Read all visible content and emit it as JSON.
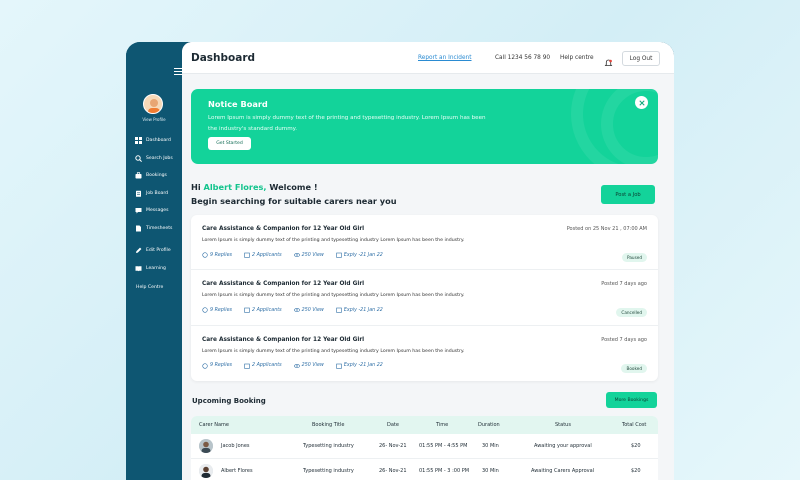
{
  "sidebar": {
    "view_profile": "View Profile",
    "items": [
      {
        "label": "Dashboard",
        "icon": "grid-icon"
      },
      {
        "label": "Search Jobs",
        "icon": "search-icon"
      },
      {
        "label": "Bookings",
        "icon": "briefcase-icon"
      },
      {
        "label": "Job Board",
        "icon": "clipboard-icon"
      },
      {
        "label": "Messages",
        "icon": "chat-icon"
      },
      {
        "label": "Timesheets",
        "icon": "document-icon"
      },
      {
        "label": "Edit Profile",
        "icon": "edit-icon"
      },
      {
        "label": "Learning",
        "icon": "book-icon"
      }
    ],
    "help": "Help Centre"
  },
  "header": {
    "title": "Dashboard",
    "report_link": "Report an Incident",
    "call": "Call 1234 56 78 90",
    "help": "Help centre",
    "logout": "Log Out"
  },
  "notice": {
    "title": "Notice Board",
    "text": "Lorem Ipsum is simply dummy text of the printing and typesetting industry. Lorem Ipsum has been the industry's standard dummy.",
    "button": "Get Started"
  },
  "greeting": {
    "hi": "Hi",
    "name": "Albert Flores,",
    "welcome": "Welcome !",
    "line2": "Begin searching for suitable carers near you",
    "post_job": "Post a Job"
  },
  "jobs": [
    {
      "title": "Care Assistance & Companion for 12 Year Old Girl",
      "desc": "Lorem Ipsum is simply dummy text of the printing and typesetting industry Lorem Ipsum has been the industry.",
      "posted": "Posted on 25 Nov 21 , 07:00 AM",
      "replies": "9 Replies",
      "applicants": "2 Applicants",
      "views": "250 View",
      "expiry": "Expiy -21 Jan 22",
      "status": "Paused"
    },
    {
      "title": "Care Assistance & Companion for 12 Year Old Girl",
      "desc": "Lorem Ipsum is simply dummy text of the printing and typesetting industry Lorem Ipsum has been the industry.",
      "posted": "Posted 7 days ago",
      "replies": "9 Replies",
      "applicants": "2 Applicants",
      "views": "250 View",
      "expiry": "Expiy -21 Jan 22",
      "status": "Cancelled"
    },
    {
      "title": "Care Assistance & Companion for 12 Year Old Girl",
      "desc": "Lorem Ipsum is simply dummy text of the printing and typesetting industry Lorem Ipsum has been the industry.",
      "posted": "Posted 7 days ago",
      "replies": "9 Replies",
      "applicants": "2 Applicants",
      "views": "250 View",
      "expiry": "Expiy -21 Jan 22",
      "status": "Booked"
    }
  ],
  "upcoming": {
    "title": "Upcoming Booking",
    "more": "More Bookings",
    "columns": [
      "Carer Name",
      "Booking Title",
      "Date",
      "Time",
      "Duration",
      "Status",
      "Total Cost"
    ],
    "rows": [
      [
        "Jacob Jones",
        "Typesetting industry",
        "26- Nov-21",
        "01:55 PM - 4:55 PM",
        "30 Min",
        "Awaiting your approval",
        "$20"
      ],
      [
        "Albert Flores",
        "Typesetting industry",
        "26- Nov-21",
        "01:55 PM - 3 :00 PM",
        "30 Min",
        "Awaiting Carers Approval",
        "$20"
      ]
    ]
  },
  "colors": {
    "sidebar": "#0e5672",
    "accent": "#13d39a",
    "link": "#2a8bd2"
  }
}
